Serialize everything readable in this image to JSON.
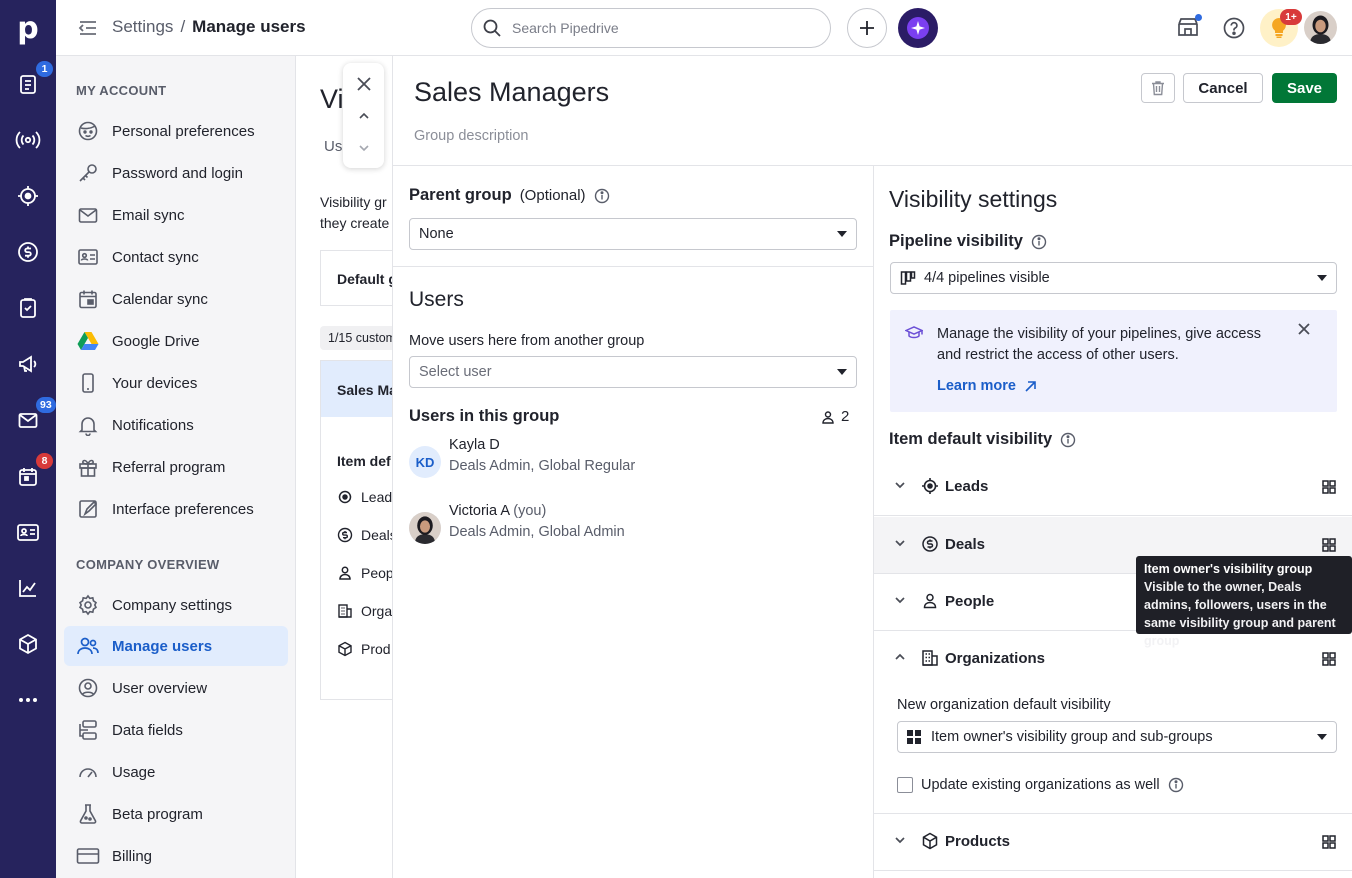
{
  "rail": {
    "logo": "p",
    "items": [
      {
        "icon": "deals-list-icon",
        "badge": "1"
      },
      {
        "icon": "campaigns-signal-icon",
        "badge": ""
      },
      {
        "icon": "leads-target-icon",
        "badge": ""
      },
      {
        "icon": "dollar-icon",
        "badge": ""
      },
      {
        "icon": "activities-checklist-icon",
        "badge": ""
      },
      {
        "icon": "megaphone-icon",
        "badge": ""
      },
      {
        "icon": "mail-icon",
        "badge": "93"
      },
      {
        "icon": "calendar-icon",
        "badge": "8"
      },
      {
        "icon": "contacts-card-icon",
        "badge": ""
      },
      {
        "icon": "insights-chart-icon",
        "badge": ""
      },
      {
        "icon": "products-box-icon",
        "badge": ""
      },
      {
        "icon": "more-dots-icon",
        "badge": ""
      }
    ]
  },
  "topbar": {
    "breadcrumb_parent": "Settings",
    "breadcrumb_sep": "/",
    "breadcrumb_current": "Manage users",
    "search_placeholder": "Search Pipedrive",
    "bulb_badge": "1+"
  },
  "sidenav": {
    "my_account_heading": "MY ACCOUNT",
    "my_account_items": [
      {
        "label": "Personal preferences",
        "icon": "face-icon"
      },
      {
        "label": "Password and login",
        "icon": "key-icon"
      },
      {
        "label": "Email sync",
        "icon": "envelope-icon"
      },
      {
        "label": "Contact sync",
        "icon": "contact-card-icon"
      },
      {
        "label": "Calendar sync",
        "icon": "calendar-sync-icon"
      },
      {
        "label": "Google Drive",
        "icon": "google-drive-icon"
      },
      {
        "label": "Your devices",
        "icon": "phone-icon"
      },
      {
        "label": "Notifications",
        "icon": "bell-icon"
      },
      {
        "label": "Referral program",
        "icon": "gift-icon"
      },
      {
        "label": "Interface preferences",
        "icon": "interface-icon"
      }
    ],
    "company_heading": "COMPANY OVERVIEW",
    "company_items": [
      {
        "label": "Company settings",
        "icon": "cog-icon"
      },
      {
        "label": "Manage users",
        "icon": "users-icon",
        "active": true
      },
      {
        "label": "User overview",
        "icon": "user-circle-icon"
      },
      {
        "label": "Data fields",
        "icon": "data-fields-icon"
      },
      {
        "label": "Usage",
        "icon": "gauge-icon"
      },
      {
        "label": "Beta program",
        "icon": "flask-icon"
      },
      {
        "label": "Billing",
        "icon": "card-icon"
      }
    ]
  },
  "background": {
    "title": "Vi",
    "tab": "Use",
    "desc_line1": "Visibility gr",
    "desc_line2": "they create",
    "default_box": "Default g",
    "pill": "1/15 custom",
    "group_header": "Sales Ma",
    "item_def": "Item def",
    "rows": [
      "Lead",
      "Deals",
      "Peop",
      "Orga",
      "Prod"
    ]
  },
  "panel": {
    "title": "Sales Managers",
    "description_placeholder": "Group description",
    "cancel_label": "Cancel",
    "save_label": "Save",
    "parent_group_label": "Parent group",
    "parent_group_optional": "(Optional)",
    "parent_group_value": "None",
    "users_heading": "Users",
    "move_users_label": "Move users here from another group",
    "select_user_placeholder": "Select user",
    "users_in_group_label": "Users in this group",
    "users_count": "2",
    "users": [
      {
        "initials": "KD",
        "name": "Kayla D",
        "you": "",
        "roles": "Deals Admin, Global Regular"
      },
      {
        "initials": "",
        "name": "Victoria A",
        "you": "(you)",
        "roles": "Deals Admin, Global Admin"
      }
    ]
  },
  "visibility": {
    "heading": "Visibility settings",
    "pipeline_label": "Pipeline visibility",
    "pipeline_value": "4/4 pipelines visible",
    "info_text": "Manage the visibility of your pipelines, give access and restrict the access of other users.",
    "learn_more": "Learn more",
    "item_default_label": "Item default visibility",
    "items": [
      {
        "label": "Leads",
        "icon": "leads-target-icon",
        "expanded": false
      },
      {
        "label": "Deals",
        "icon": "dollar-icon",
        "expanded": false
      },
      {
        "label": "People",
        "icon": "person-icon",
        "expanded": false
      },
      {
        "label": "Organizations",
        "icon": "building-icon",
        "expanded": true
      },
      {
        "label": "Products",
        "icon": "products-box-icon",
        "expanded": false
      }
    ],
    "org_new_default_label": "New organization default visibility",
    "org_default_value": "Item owner's visibility group and sub-groups",
    "update_existing_label": "Update existing organizations as well"
  },
  "tooltip": {
    "title": "Item owner's visibility group",
    "body": "Visible to the owner, Deals admins, followers, users in the same visibility group and parent group"
  },
  "colors": {
    "rail_bg": "#26235d",
    "accent_blue": "#1b5ec9",
    "save_green": "#017737",
    "active_nav_bg": "#e1ecfd"
  }
}
